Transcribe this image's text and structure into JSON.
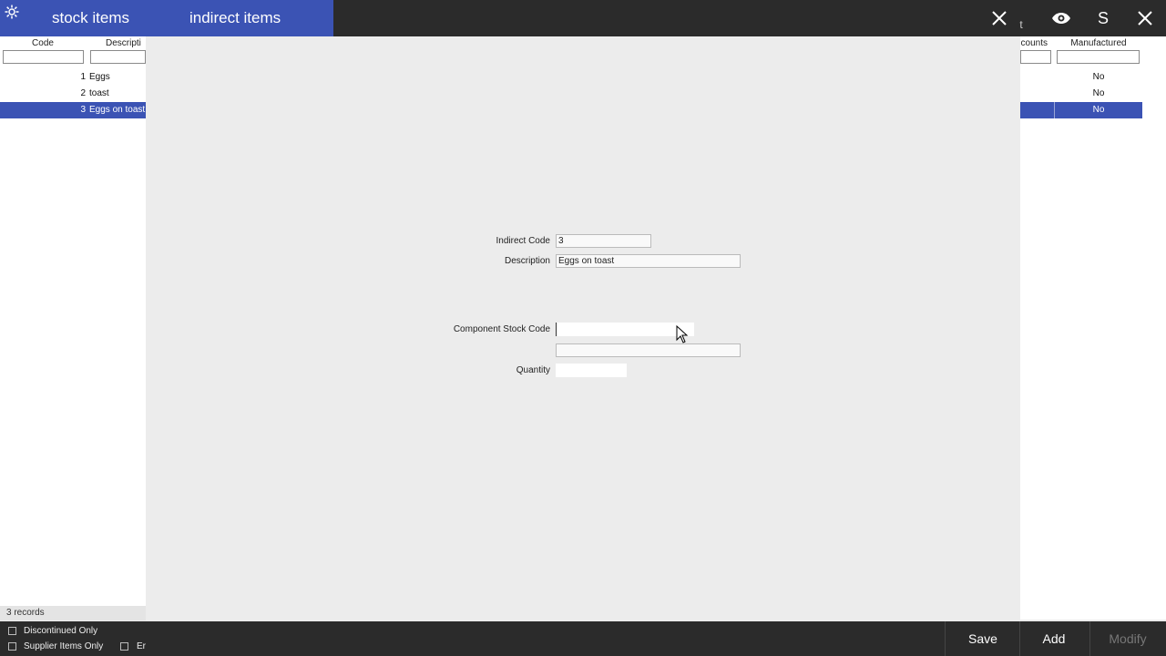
{
  "tabs": {
    "stock": "stock items",
    "indirect": "indirect items"
  },
  "titlebar_icons": [
    "gear-icon",
    "close-icon",
    "eye-icon",
    "close-icon"
  ],
  "titlebar_t": "t",
  "titlebar_s": "S",
  "left_grid": {
    "headers": {
      "code": "Code",
      "description": "Descripti"
    },
    "rows": [
      {
        "code": "1",
        "desc": "Eggs"
      },
      {
        "code": "2",
        "desc": "toast"
      },
      {
        "code": "3",
        "desc": "Eggs on toast"
      }
    ],
    "records": "3 records"
  },
  "right_grid": {
    "headers": {
      "counts": "counts",
      "manufactured": "Manufactured"
    },
    "rows": [
      {
        "manufactured": "No"
      },
      {
        "manufactured": "No"
      },
      {
        "manufactured": "No"
      }
    ]
  },
  "form": {
    "indirect_code_label": "Indirect Code",
    "indirect_code_value": "3",
    "description_label": "Description",
    "description_value": "Eggs on toast",
    "component_stock_code_label": "Component Stock Code",
    "component_stock_code_value": "",
    "component_description_value": "",
    "quantity_label": "Quantity",
    "quantity_value": ""
  },
  "bottom": {
    "discontinued_only": "Discontinued Only",
    "supplier_items_only": "Supplier Items Only",
    "third_filter": "Er",
    "save": "Save",
    "add": "Add",
    "modify": "Modify"
  },
  "colors": {
    "accent": "#3b53b4",
    "titlebar": "#2b2b2b",
    "background": "#ececec"
  }
}
